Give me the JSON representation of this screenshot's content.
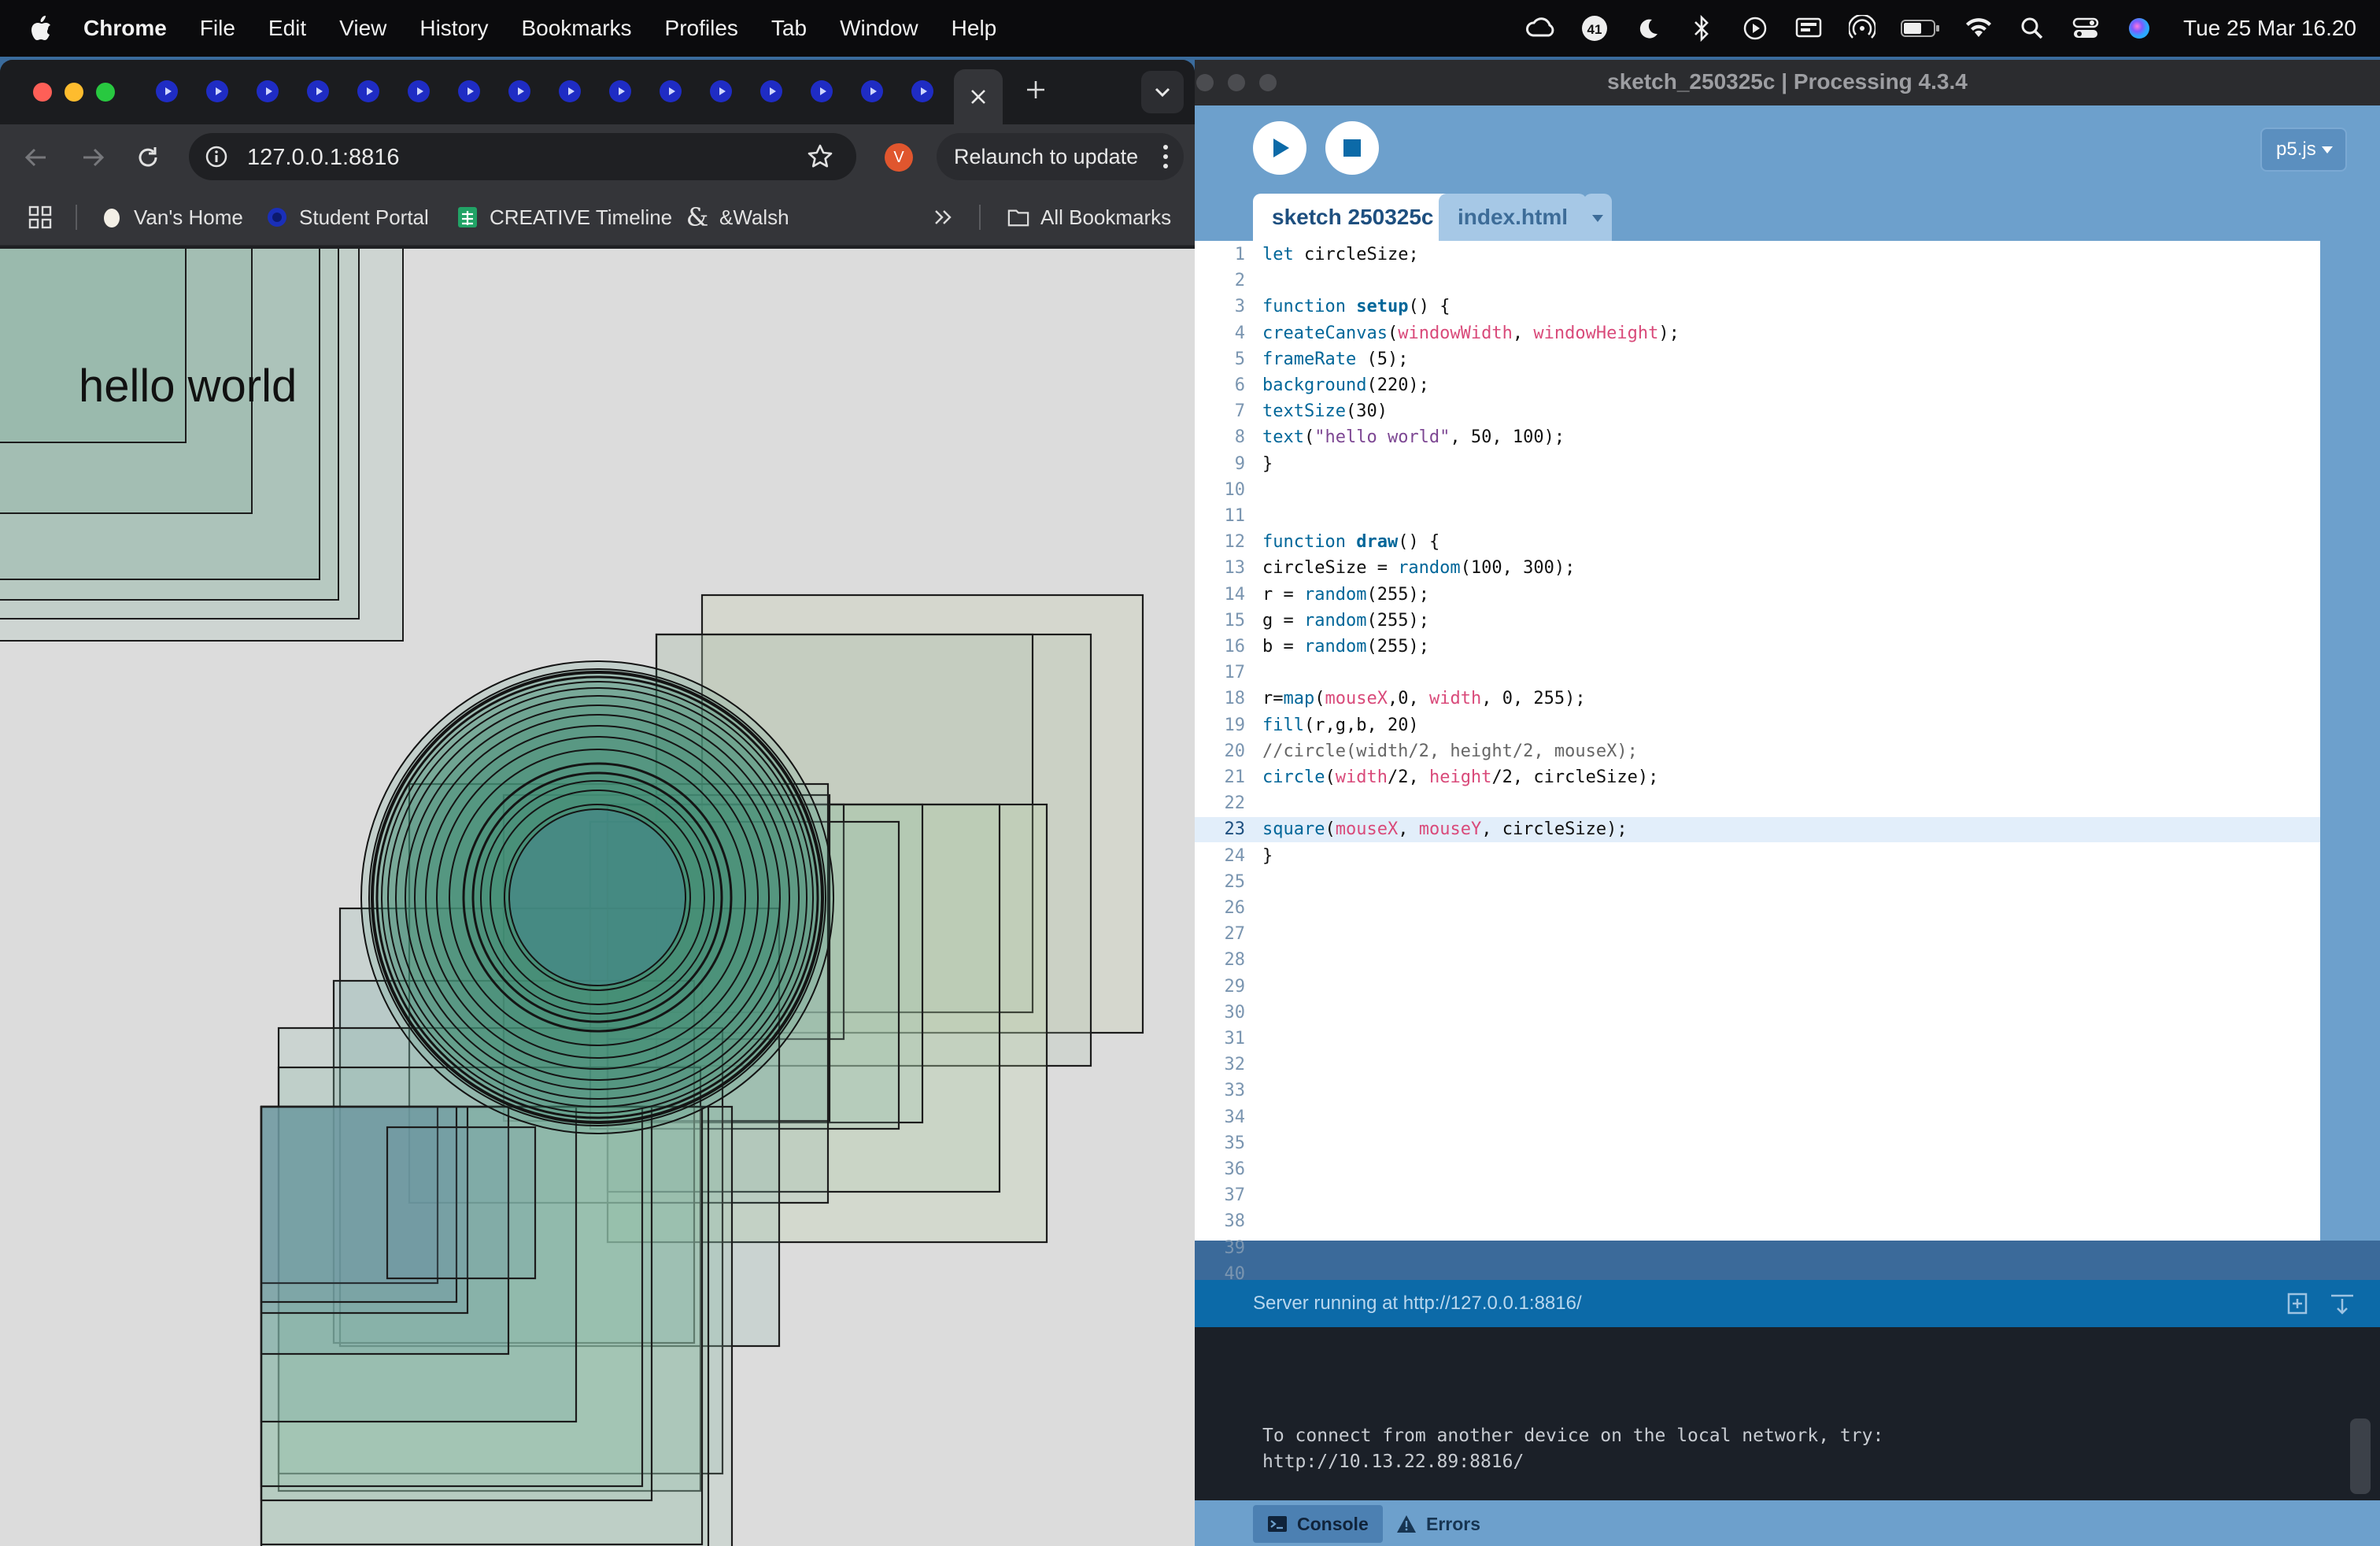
{
  "menubar": {
    "app_name": "Chrome",
    "items": [
      "File",
      "Edit",
      "View",
      "History",
      "Bookmarks",
      "Profiles",
      "Tab",
      "Window",
      "Help"
    ],
    "status_icons": [
      "creative-cloud-icon",
      "notification-badge-icon",
      "moon-icon",
      "bluetooth-icon",
      "play-icon",
      "screen-mirror-icon",
      "airdrop-icon",
      "battery-icon",
      "wifi-icon",
      "spotlight-icon",
      "control-center-icon",
      "siri-icon"
    ],
    "badge_count": "41",
    "clock": "Tue 25 Mar  16.20"
  },
  "chrome": {
    "tab_count_icons": 16,
    "address": "127.0.0.1:8816",
    "profile_initial": "V",
    "relaunch_label": "Relaunch to update",
    "bookmarks": [
      {
        "label": "Van's Home",
        "icon": "egg-icon"
      },
      {
        "label": "Student Portal",
        "icon": "portal-icon"
      },
      {
        "label": "CREATIVE Timeline",
        "icon": "sheets-icon"
      },
      {
        "label": "&Walsh",
        "icon": "ampersand-icon"
      }
    ],
    "all_bookmarks_label": "All Bookmarks",
    "canvas": {
      "text": "hello world",
      "background": "#dcdcdc"
    }
  },
  "processing": {
    "window_title": "sketch_250325c | Processing 4.3.4",
    "mode": "p5.js",
    "tabs": [
      "sketch 250325c",
      "index.html"
    ],
    "code_lines": [
      "let circleSize;",
      "",
      "function setup() {",
      "createCanvas(windowWidth, windowHeight);",
      "frameRate (5);",
      "background(220);",
      "textSize(30)",
      "text(\"hello world\", 50, 100);",
      "}",
      "",
      "",
      "function draw() {",
      "circleSize = random(100, 300);",
      "r = random(255);",
      "g = random(255);",
      "b = random(255);",
      "",
      "r=map(mouseX,0, width, 0, 255);",
      "fill(r,g,b, 20)",
      "//circle(width/2, height/2, mouseX);",
      "circle(width/2, height/2, circleSize);",
      "",
      "square(mouseX, mouseY, circleSize);",
      "}"
    ],
    "total_lines": 40,
    "active_line": 23,
    "status_message": "Server running at http://127.0.0.1:8816/",
    "console_text": "To connect from another device on the local network, try:\nhttp://10.13.22.89:8816/",
    "console_tabs": [
      "Console",
      "Errors"
    ]
  }
}
